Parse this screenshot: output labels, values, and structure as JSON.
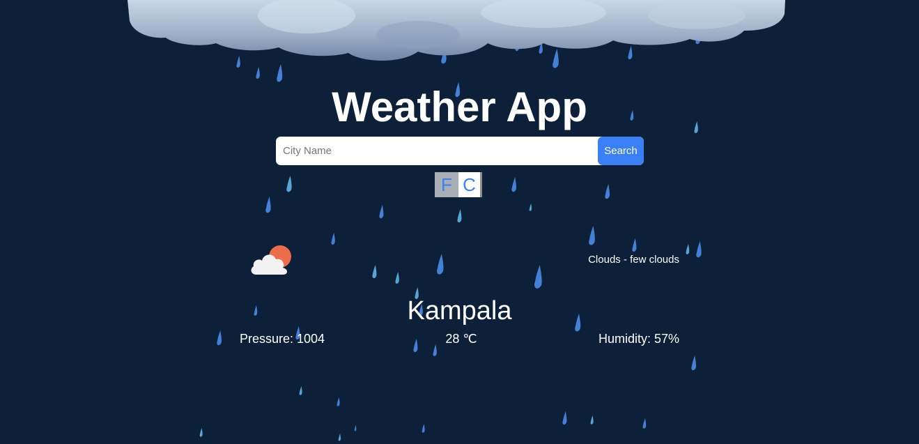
{
  "app": {
    "title": "Weather App"
  },
  "search": {
    "placeholder": "City Name",
    "value": "",
    "button_label": "Search"
  },
  "units": {
    "fahrenheit_label": "F",
    "celsius_label": "C",
    "selected": "F"
  },
  "weather": {
    "icon": "few-clouds-day-icon",
    "description": "Clouds - few clouds",
    "city": "Kampala",
    "pressure_text": "Pressure: 1004",
    "temperature_text": "28 ℃",
    "humidity_text": "Humidity: 57%"
  },
  "colors": {
    "background": "#0c2139",
    "accent": "#3b7ff5",
    "raindrop": "#4a8be8",
    "raindrop_light": "#5fb6e8",
    "sun": "#ec6c4b",
    "cloud": "#f2f2f2"
  }
}
